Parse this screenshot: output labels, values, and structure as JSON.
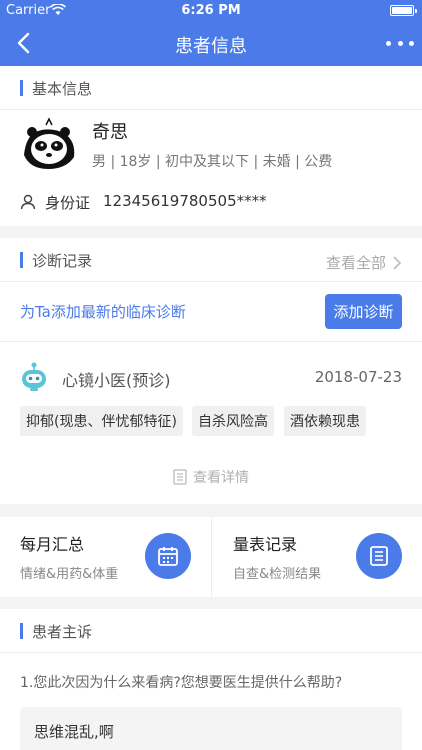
{
  "status": {
    "carrier": "Carrier",
    "time": "6:26 PM"
  },
  "nav": {
    "title": "患者信息"
  },
  "basic": {
    "section_title": "基本信息",
    "name": "奇思",
    "meta": "男 | 18岁 | 初中及其以下 | 未婚 | 公费",
    "id_label": "身份证",
    "id_value": "12345619780505****"
  },
  "diagnosis": {
    "section_title": "诊断记录",
    "view_all": "查看全部",
    "add_prompt": "为Ta添加最新的临床诊断",
    "add_button": "添加诊断",
    "record": {
      "doctor": "心镜小医(预诊)",
      "date": "2018-07-23",
      "tags": [
        "抑郁(现患、伴忧郁特征)",
        "自杀风险高",
        "酒依赖现患"
      ],
      "details_label": "查看详情"
    }
  },
  "tiles": [
    {
      "title": "每月汇总",
      "subtitle": "情绪&用药&体重",
      "icon": "calendar-icon"
    },
    {
      "title": "量表记录",
      "subtitle": "自查&检测结果",
      "icon": "document-list-icon"
    }
  ],
  "complaint": {
    "section_title": "患者主诉",
    "question": "1.您此次因为什么来看病?您想要医生提供什么帮助?",
    "answer": "思维混乱,啊"
  },
  "colors": {
    "accent": "#4a7be8",
    "background": "#f2f3f5"
  }
}
